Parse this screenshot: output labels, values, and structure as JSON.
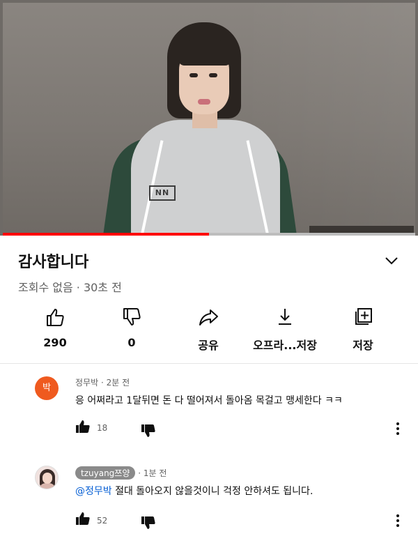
{
  "video": {
    "title": "감사합니다",
    "meta": "조회수 없음 · 30초 전",
    "progress": 0.5,
    "shirt_logo": "NN"
  },
  "actions": [
    {
      "name": "like",
      "label": "290"
    },
    {
      "name": "dislike",
      "label": "0"
    },
    {
      "name": "share",
      "label": "공유"
    },
    {
      "name": "download",
      "label": "오프라...저장"
    },
    {
      "name": "save",
      "label": "저장"
    }
  ],
  "comments": [
    {
      "avatar_text": "박",
      "author": "정무박",
      "time": "· 2분 전",
      "mention": "",
      "text": "응 어쩌라고 1달뒤면 돈 다 떨어져서 돌아옴 목걸고 맹세한다 ㅋㅋ",
      "likes": "18"
    },
    {
      "avatar_text": "",
      "author": "tzuyang쯔양",
      "time": "· 1분 전",
      "mention": "@정무박",
      "text": " 절대 돌아오지 않을것이니 걱정 안하셔도 됩니다.",
      "likes": "52"
    }
  ],
  "colors": {
    "progress": "#ff0000",
    "avatar": "#ef5a1f",
    "mention": "#065fd4"
  }
}
